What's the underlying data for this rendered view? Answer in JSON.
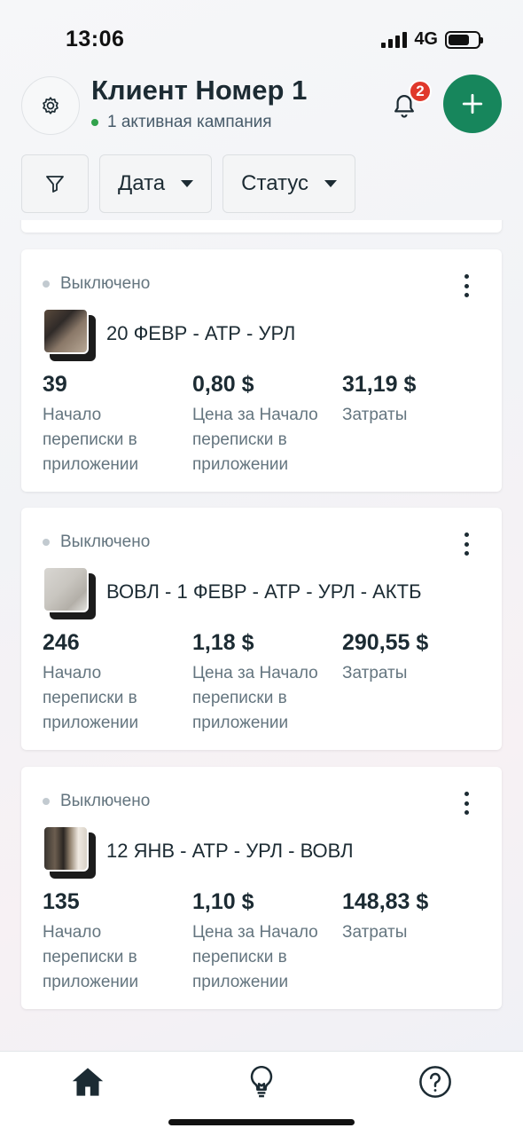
{
  "status_bar": {
    "time": "13:06",
    "network": "4G"
  },
  "header": {
    "title": "Клиент Номер 1",
    "subtitle": "1 активная кампания",
    "notification_count": "2"
  },
  "filters": [
    {
      "label": "Дата"
    },
    {
      "label": "Статус"
    }
  ],
  "campaigns": [
    {
      "status": "Выключено",
      "name": "20 ФЕВР - АТР - УРЛ",
      "metrics": [
        {
          "value": "39",
          "label": "Начало переписки в приложении"
        },
        {
          "value": "0,80 $",
          "label": "Цена за Начало переписки в приложении"
        },
        {
          "value": "31,19 $",
          "label": "Затраты"
        }
      ]
    },
    {
      "status": "Выключено",
      "name": "ВОВЛ - 1 ФЕВР - АТР - УРЛ - АКТБ",
      "metrics": [
        {
          "value": "246",
          "label": "Начало переписки в приложении"
        },
        {
          "value": "1,18 $",
          "label": "Цена за Начало переписки в приложении"
        },
        {
          "value": "290,55 $",
          "label": "Затраты"
        }
      ]
    },
    {
      "status": "Выключено",
      "name": "12 ЯНВ - АТР - УРЛ - ВОВЛ",
      "metrics": [
        {
          "value": "135",
          "label": "Начало переписки в приложении"
        },
        {
          "value": "1,10 $",
          "label": "Цена за Начало переписки в приложении"
        },
        {
          "value": "148,83 $",
          "label": "Затраты"
        }
      ]
    }
  ],
  "bottom_nav": [
    {
      "icon": "home-icon",
      "active": true
    },
    {
      "icon": "lightbulb-icon",
      "active": false
    },
    {
      "icon": "help-icon",
      "active": false
    }
  ],
  "colors": {
    "accent_green": "#17865c",
    "badge_red": "#e0382b",
    "active_dot": "#31a24c",
    "inactive_dot": "#c2cad0",
    "text_primary": "#1c2b33",
    "text_secondary": "#64757f"
  }
}
